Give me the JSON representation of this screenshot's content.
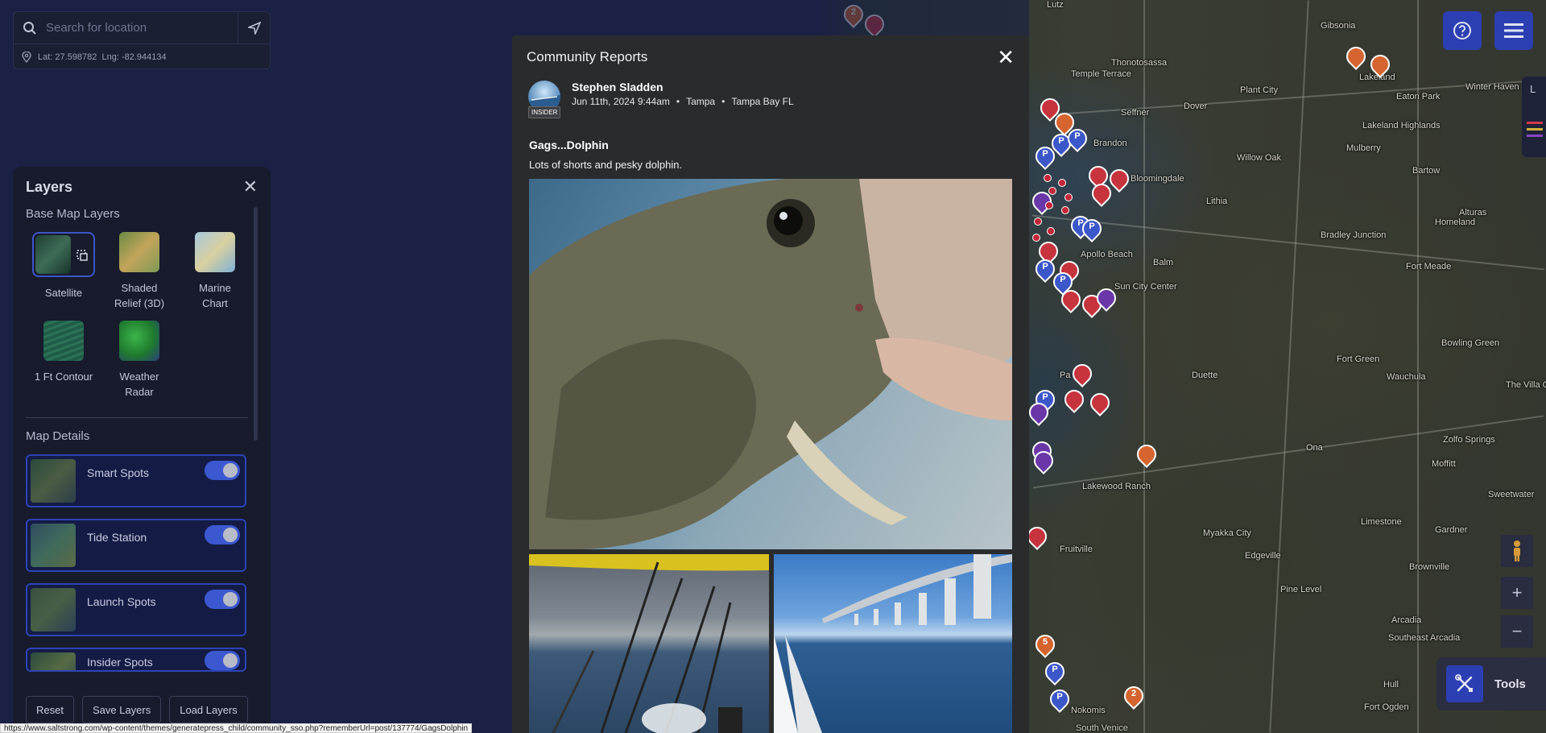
{
  "search": {
    "placeholder": "Search for location",
    "coords": "Lat: 27.598782  Lng: -82.944134"
  },
  "layers": {
    "title": "Layers",
    "base_section": "Base Map Layers",
    "base_items": [
      {
        "label": "Satellite",
        "selected": true
      },
      {
        "label": "Shaded Relief (3D)",
        "selected": false
      },
      {
        "label": "Marine Chart",
        "selected": false
      },
      {
        "label": "1 Ft Contour",
        "selected": false
      },
      {
        "label": "Weather Radar",
        "selected": false
      }
    ],
    "details_section": "Map Details",
    "details": [
      {
        "label": "Smart Spots",
        "enabled": true
      },
      {
        "label": "Tide Station",
        "enabled": true
      },
      {
        "label": "Launch Spots",
        "enabled": true
      },
      {
        "label": "Insider Spots",
        "enabled": true
      }
    ],
    "buttons": {
      "reset": "Reset",
      "save": "Save Layers",
      "load": "Load Layers"
    }
  },
  "modal": {
    "title": "Community Reports",
    "author": {
      "name": "Stephen Sladden",
      "badge": "INSIDER",
      "date": "Jun 11th, 2024 9:44am",
      "city": "Tampa",
      "region": "Tampa Bay FL"
    },
    "post_title": "Gags...Dolphin",
    "post_body": "Lots of shorts and pesky dolphin."
  },
  "map_labels": [
    "Lutz",
    "Gibsonia",
    "Thonotosassa",
    "Temple Terrace",
    "Plant City",
    "Lakeland",
    "Eaton Park",
    "Winter Haven",
    "Dover",
    "Seffner",
    "Lakeland Highlands",
    "Brandon",
    "Mulberry",
    "Willow Oak",
    "Bartow",
    "Bloomingdale",
    "Lithia",
    "Alturas",
    "Homeland",
    "Bradley Junction",
    "Balm",
    "Fort Meade",
    "Apollo Beach",
    "Sun City Center",
    "Fort Green",
    "Bowling Green",
    "Duette",
    "The Villa Charlie C",
    "Wauchula",
    "Ona",
    "Zolfo Springs",
    "Moffitt",
    "Lakewood Ranch",
    "Sweetwater",
    "Limestone",
    "Myakka City",
    "Gardner",
    "Fruitville",
    "Edgeville",
    "Brownville",
    "Pine Level",
    "Arcadia",
    "Southeast Arcadia",
    "Hull",
    "Fort Ogden",
    "South Venice",
    "Nokomis",
    "Pa"
  ],
  "map_controls": {
    "tools_label": "Tools",
    "side_letter": "L",
    "zoom_in": "+",
    "zoom_out": "−"
  },
  "statusbar": "https://www.saltstrong.com/wp-content/themes/generatepress_child/community_sso.php?rememberUrl=post/137774/GagsDolphin",
  "colors": {
    "accent": "#2c3fb2",
    "pin_red": "#c7343e",
    "pin_blue": "#3c57c9",
    "pin_purple": "#6a37a8",
    "pin_orange": "#d5642f"
  }
}
